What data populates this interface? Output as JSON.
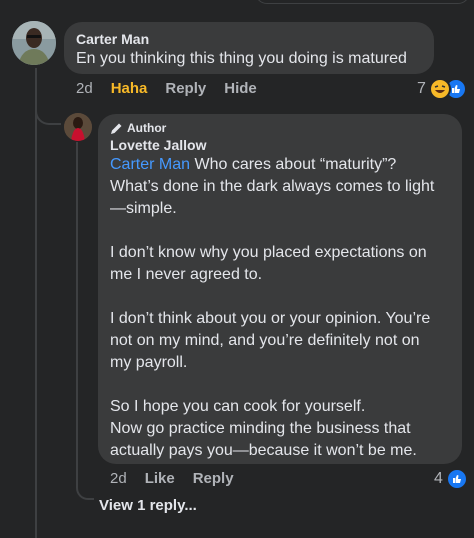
{
  "comment": {
    "author": "Carter Man",
    "text": "En you thinking this thing you doing is matured",
    "time": "2d",
    "actions": {
      "reaction": "Haha",
      "reply": "Reply",
      "hide": "Hide"
    },
    "reaction_count": "7"
  },
  "reply": {
    "badge": "Author",
    "author": "Lovette Jallow",
    "mention": "Carter Man",
    "lines_first": [
      " Who cares about “maturity”?",
      "What’s done in the dark always comes to light",
      "—simple."
    ],
    "para2": [
      "I don’t know why you placed expectations on",
      "me I never agreed to."
    ],
    "para3": [
      "I don’t think about you or your opinion. You’re",
      "not on my mind, and you’re definitely not on",
      "my payroll."
    ],
    "para4": [
      "So I hope you can cook for yourself.",
      "Now go practice minding the business that",
      "actually pays you—because it won’t be me."
    ],
    "time": "2d",
    "actions": {
      "like": "Like",
      "reply": "Reply"
    },
    "reaction_count": "4"
  },
  "view_replies": "View 1 reply...",
  "colors": {
    "background": "#242526",
    "bubble": "#3a3b3c",
    "mention": "#4599ff",
    "haha": "#f7b928",
    "like": "#1877f2"
  },
  "icons": [
    "pencil-icon",
    "haha-emoji-icon",
    "like-icon"
  ]
}
